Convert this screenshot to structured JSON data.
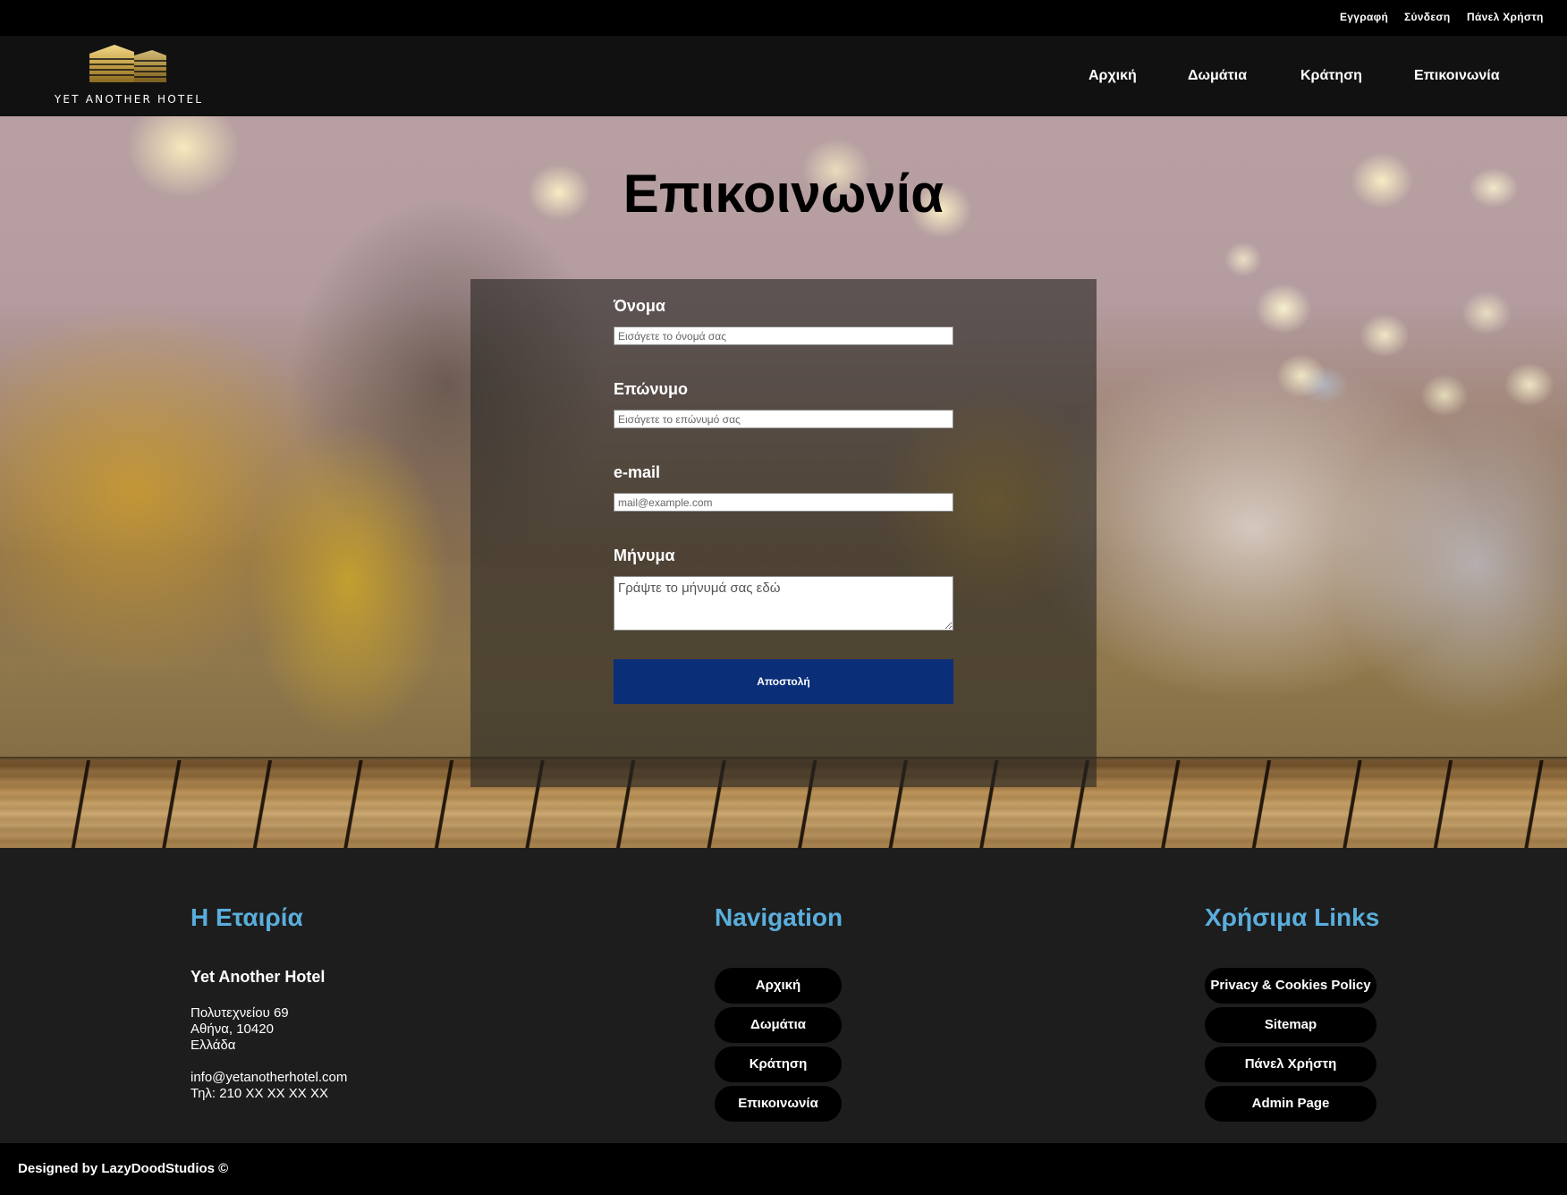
{
  "topbar": {
    "register": "Εγγραφή",
    "login": "Σύνδεση",
    "user_panel": "Πάνελ Χρήστη"
  },
  "brand": {
    "name": "YET ANOTHER HOTEL",
    "logo_color": "#c9a54a"
  },
  "nav": {
    "home": "Αρχική",
    "rooms": "Δωμάτια",
    "booking": "Κράτηση",
    "contact": "Επικοινωνία"
  },
  "hero": {
    "title": "Επικοινωνία"
  },
  "form": {
    "first_name_label": "Όνομα",
    "first_name_placeholder": "Εισάγετε το όνομά σας",
    "last_name_label": "Επώνυμο",
    "last_name_placeholder": "Εισάγετε το επώνυμό σας",
    "email_label": "e-mail",
    "email_placeholder": "mail@example.com",
    "message_label": "Μήνυμα",
    "message_placeholder": "Γράψτε το μήνυμά σας εδώ",
    "submit_label": "Αποστολή",
    "submit_color": "#0a2f78"
  },
  "footer": {
    "heading_color": "#5aaedc",
    "company": {
      "heading": "Η Εταιρία",
      "name": "Yet Another Hotel",
      "address_line1": "Πολυτεχνείου 69",
      "address_line2": "Αθήνα, 10420",
      "address_line3": "Ελλάδα",
      "email": "info@yetanotherhotel.com",
      "phone": "Τηλ: 210 XX XX XX XX"
    },
    "navigation": {
      "heading": "Navigation",
      "items": [
        "Αρχική",
        "Δωμάτια",
        "Κράτηση",
        "Επικοινωνία"
      ]
    },
    "useful_links": {
      "heading": "Χρήσιμα Links",
      "items": [
        "Privacy & Cookies Policy",
        "Sitemap",
        "Πάνελ Χρήστη",
        "Admin Page"
      ]
    }
  },
  "credit": "Designed by LazyDoodStudios ©"
}
